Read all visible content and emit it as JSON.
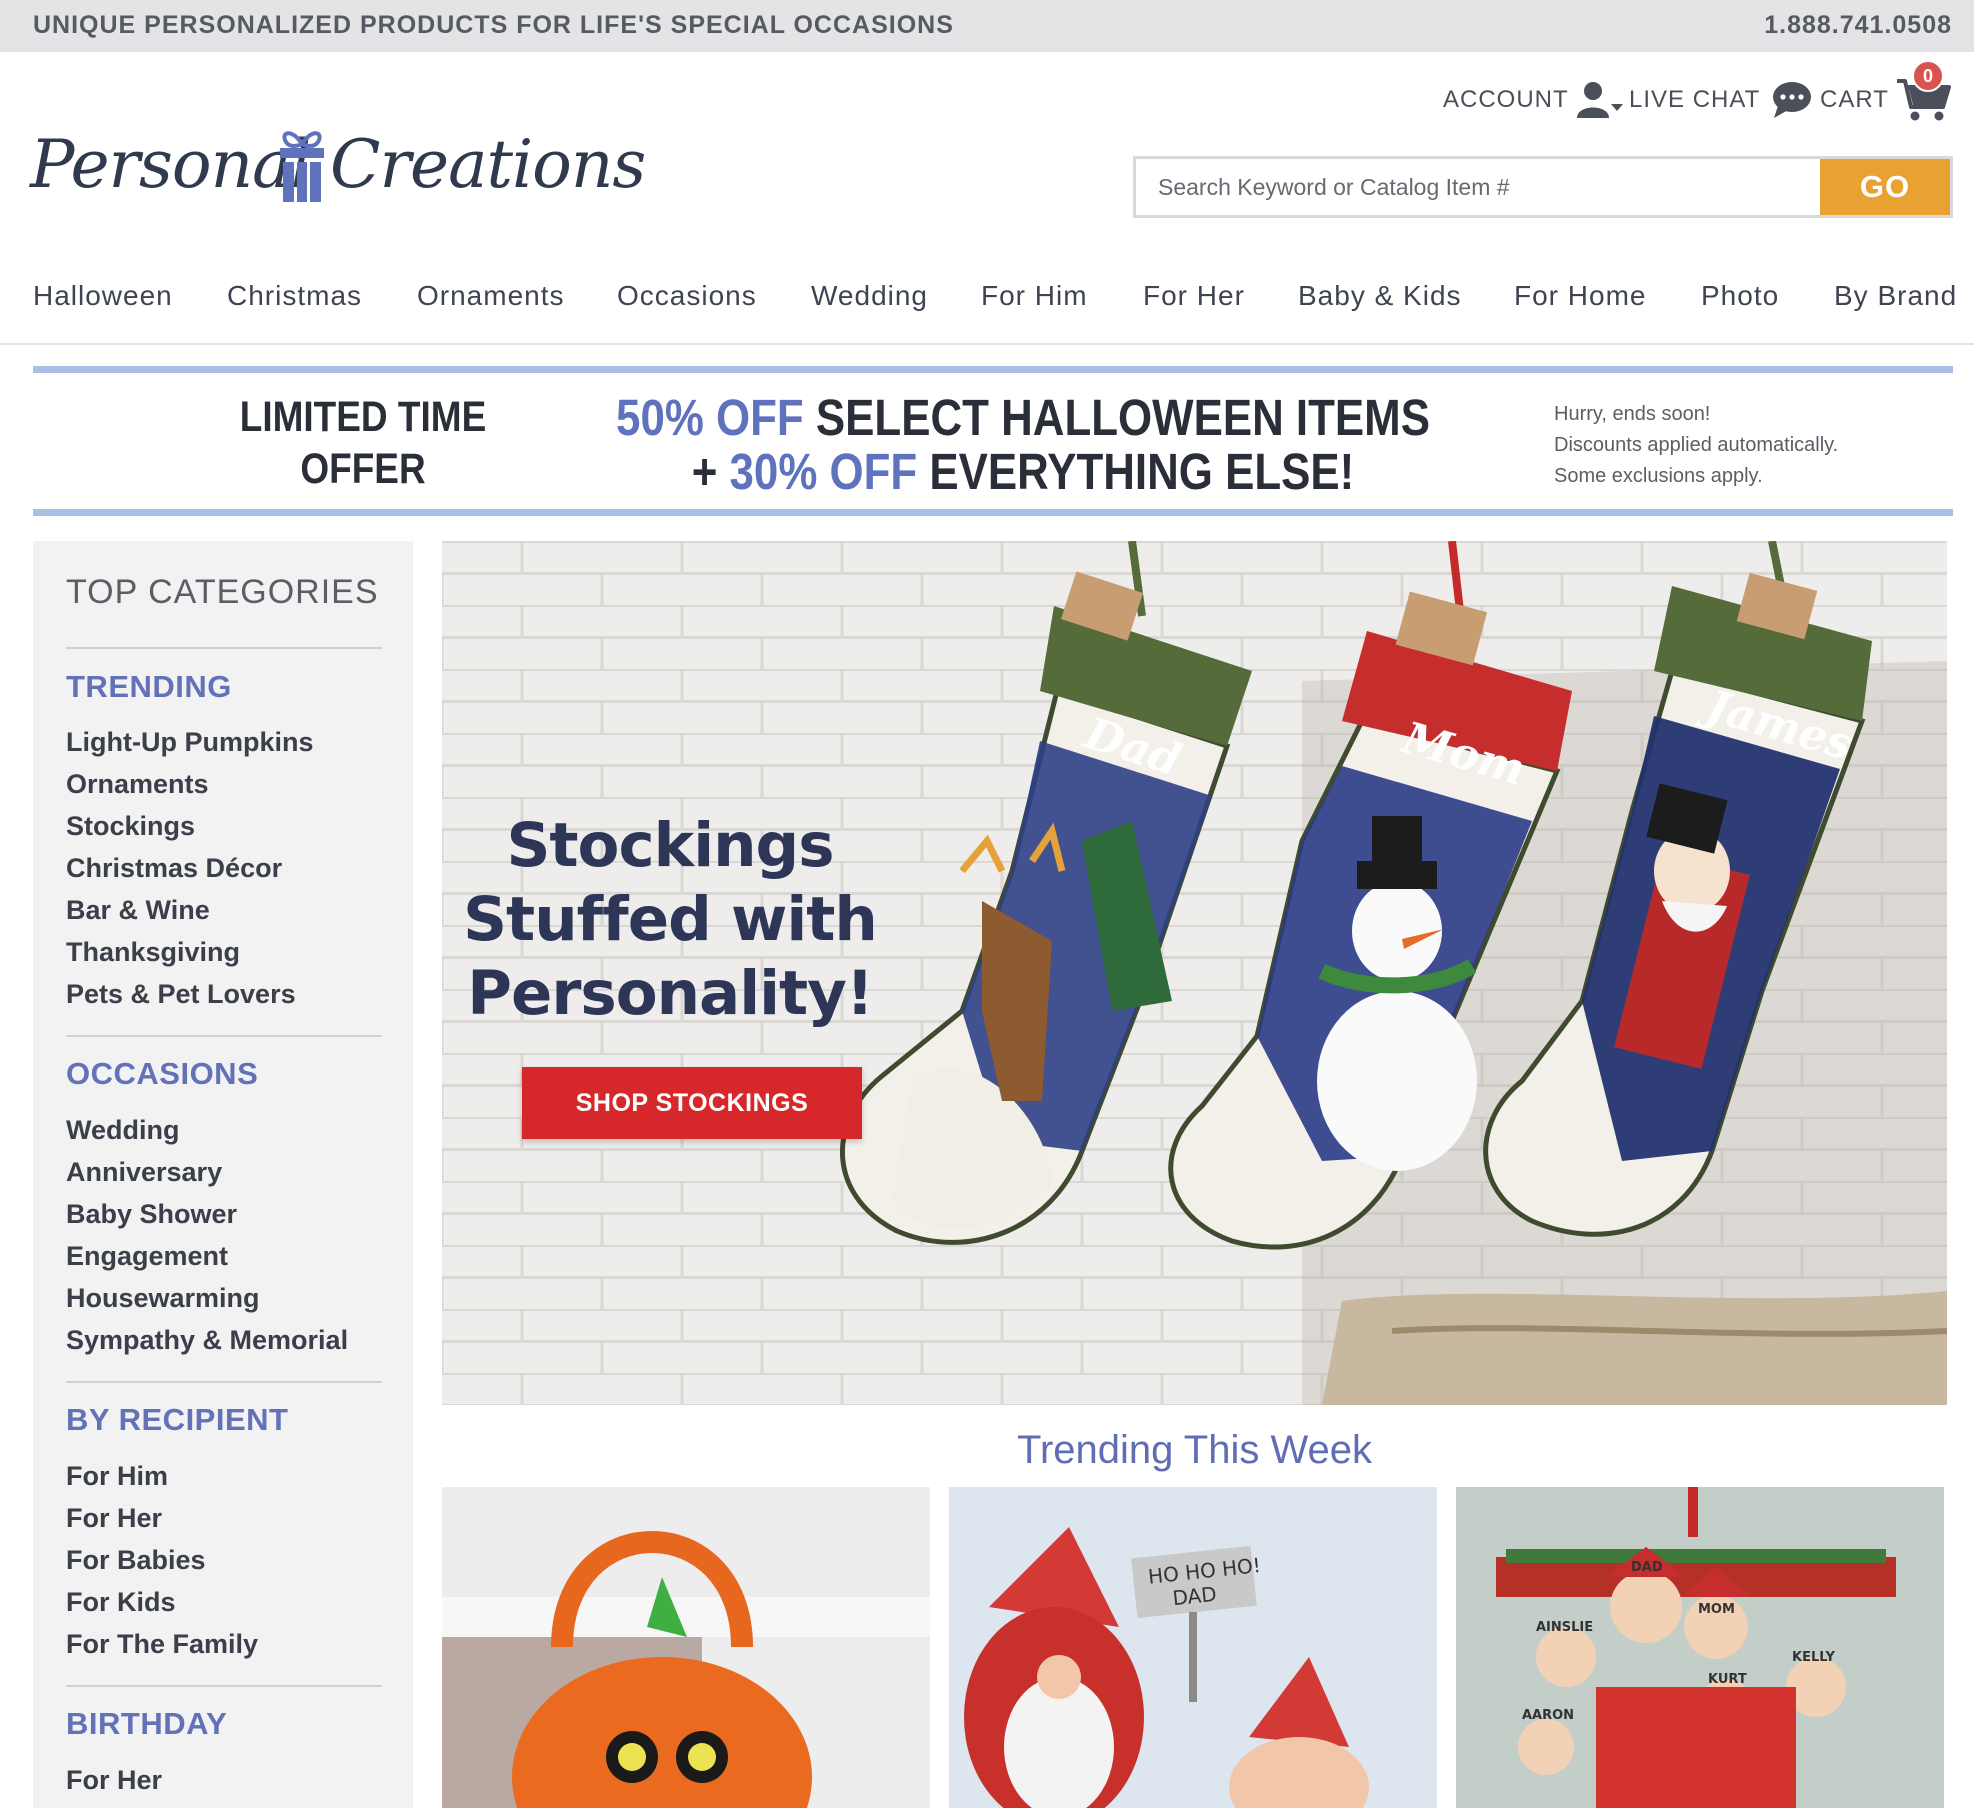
{
  "topbar": {
    "tagline": "UNIQUE PERSONALIZED PRODUCTS FOR LIFE'S SPECIAL OCCASIONS",
    "phone": "1.888.741.0508"
  },
  "header": {
    "logo_word_1": "Personal",
    "logo_word_2": "Creations",
    "account_label": "ACCOUNT",
    "chat_label": "LIVE CHAT",
    "cart_label": "CART",
    "cart_count": "0",
    "search_placeholder": "Search Keyword or Catalog Item #",
    "search_button": "GO"
  },
  "nav": {
    "items": [
      "Halloween",
      "Christmas",
      "Ornaments",
      "Occasions",
      "Wedding",
      "For Him",
      "For Her",
      "Baby & Kids",
      "For Home",
      "Photo",
      "By Brand"
    ]
  },
  "promo": {
    "limited_line1": "LIMITED TIME",
    "limited_line2": "OFFER",
    "pct1": "50% OFF",
    "text1": " SELECT HALLOWEEN ITEMS",
    "plus": "+ ",
    "pct2": "30% OFF",
    "text2": " EVERYTHING ELSE!",
    "fine1": "Hurry, ends soon!",
    "fine2": "Discounts applied automatically.",
    "fine3": "Some exclusions apply."
  },
  "sidebar": {
    "title": "TOP CATEGORIES",
    "sections": [
      {
        "heading": "TRENDING",
        "links": [
          "Light-Up Pumpkins",
          "Ornaments",
          "Stockings",
          "Christmas Décor",
          "Bar & Wine",
          "Thanksgiving",
          "Pets & Pet Lovers"
        ]
      },
      {
        "heading": "OCCASIONS",
        "links": [
          "Wedding",
          "Anniversary",
          "Baby Shower",
          "Engagement",
          "Housewarming",
          "Sympathy & Memorial"
        ]
      },
      {
        "heading": "BY RECIPIENT",
        "links": [
          "For Him",
          "For Her",
          "For Babies",
          "For Kids",
          "For The Family"
        ]
      },
      {
        "heading": "BIRTHDAY",
        "links": [
          "For Her"
        ]
      }
    ]
  },
  "hero": {
    "title_line1": "Stockings",
    "title_line2": "Stuffed with",
    "title_line3": "Personality!",
    "cta": "SHOP STOCKINGS",
    "stocking_names": [
      "Dad",
      "Mom",
      "James"
    ]
  },
  "trending": {
    "title": "Trending This Week",
    "tile2_sign_line1": "HO HO HO!",
    "tile2_sign_line2": "DAD",
    "tile3_names": [
      "DAD",
      "MOM",
      "AINSLIE",
      "KELLY",
      "KURT",
      "AARON"
    ]
  },
  "colors": {
    "accent_blue": "#6271b8",
    "promo_rule": "#a9bfe6",
    "search_button": "#e9a132",
    "cta_red": "#d6282b",
    "cart_badge": "#d9534f"
  }
}
